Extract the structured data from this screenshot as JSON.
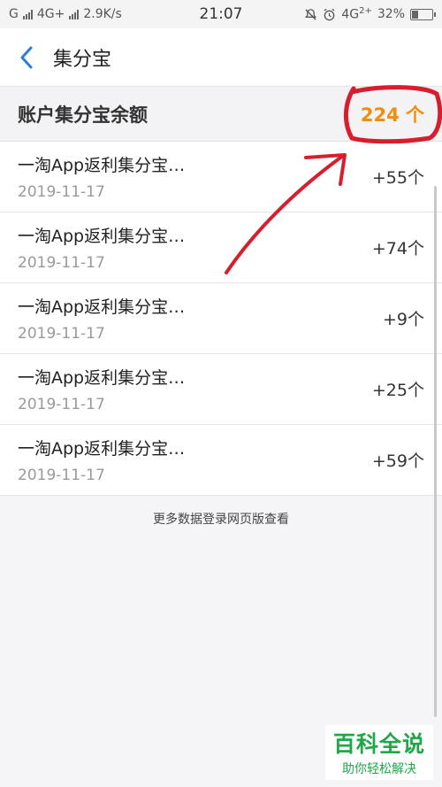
{
  "status_bar": {
    "carrier_left": "G",
    "network": "4G+",
    "speed": "2.9K/s",
    "time": "21:07",
    "network_right": "4G",
    "network_right_sup": "2+",
    "battery": "32%",
    "battery_level": 0.32
  },
  "nav": {
    "title": "集分宝"
  },
  "balance": {
    "label": "账户集分宝余额",
    "value": "224 个"
  },
  "records": [
    {
      "title": "一淘App返利集分宝…",
      "date": "2019-11-17",
      "points": "+55个"
    },
    {
      "title": "一淘App返利集分宝…",
      "date": "2019-11-17",
      "points": "+74个"
    },
    {
      "title": "一淘App返利集分宝…",
      "date": "2019-11-17",
      "points": "+9个"
    },
    {
      "title": "一淘App返利集分宝…",
      "date": "2019-11-17",
      "points": "+25个"
    },
    {
      "title": "一淘App返利集分宝…",
      "date": "2019-11-17",
      "points": "+59个"
    }
  ],
  "footer": {
    "link": "更多数据登录网页版查看"
  },
  "watermark": {
    "title": "百科全说",
    "subtitle": "助你轻松解决"
  },
  "colors": {
    "accent": "#2a7fd4",
    "balance_value": "#f28c0f",
    "annotation": "#d81e2c",
    "watermark": "#1fa74a"
  }
}
